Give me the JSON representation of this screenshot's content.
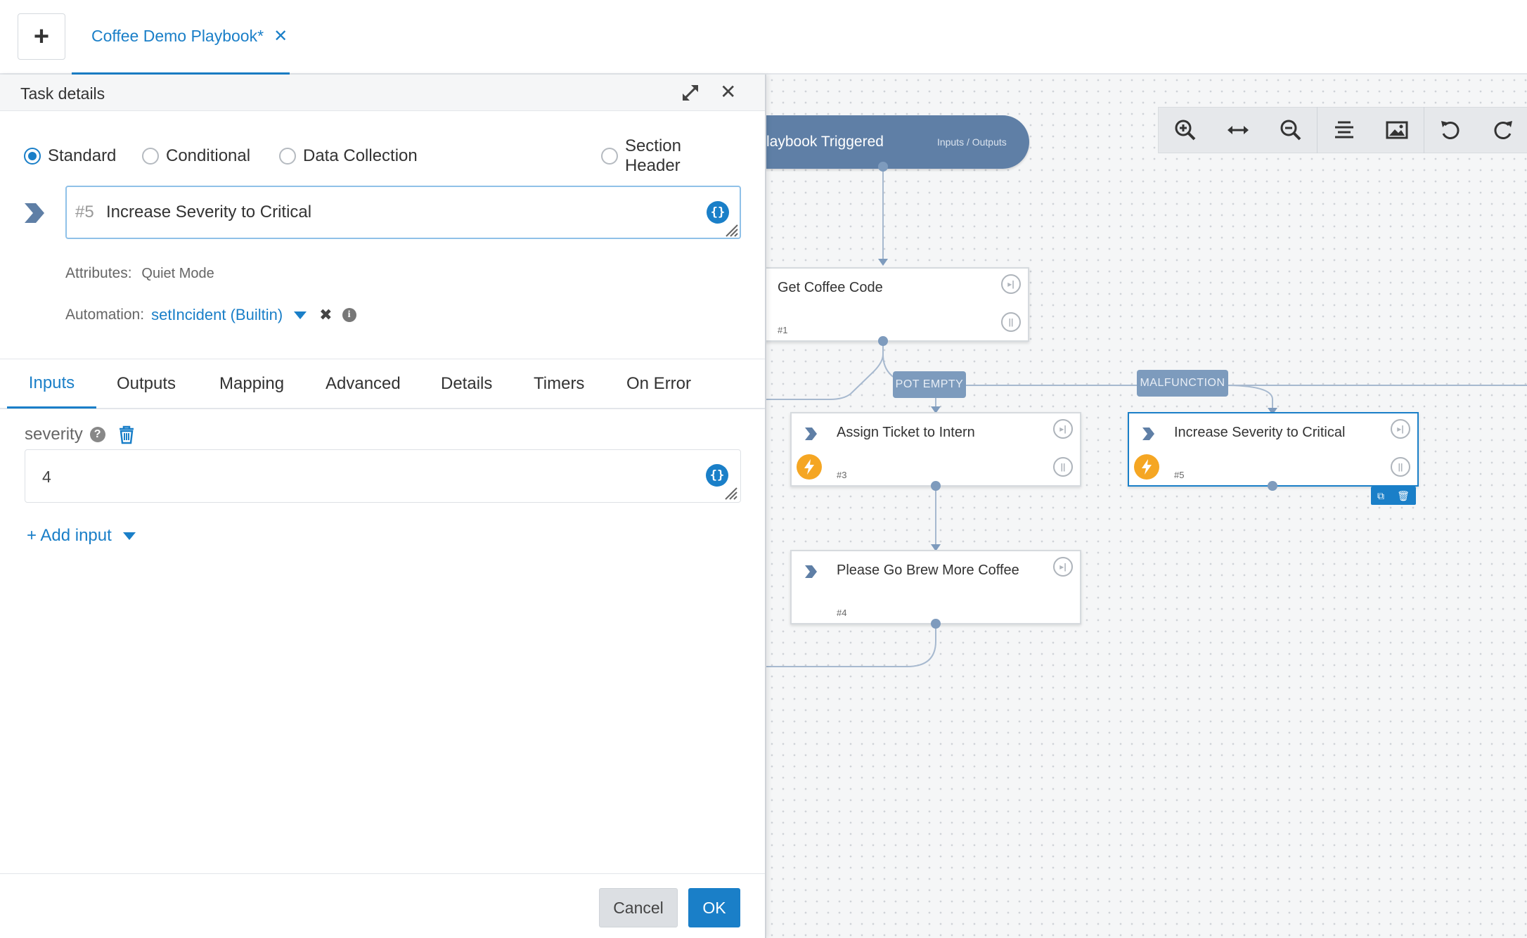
{
  "app": {
    "new_tab_icon": "plus-icon",
    "playbook_tab": {
      "label": "Coffee Demo Playbook*",
      "close_icon": "close-icon"
    }
  },
  "panel": {
    "title": "Task details",
    "task_types": [
      {
        "label": "Standard",
        "selected": true
      },
      {
        "label": "Conditional",
        "selected": false
      },
      {
        "label": "Data Collection",
        "selected": false
      },
      {
        "label": "Section Header",
        "selected": false
      }
    ],
    "task_number": "#5",
    "task_name": "Increase Severity to Critical",
    "attributes_label": "Attributes:",
    "attributes_value": "Quiet Mode",
    "automation_label": "Automation:",
    "automation_value": "setIncident (Builtin)",
    "tabs": [
      "Inputs",
      "Outputs",
      "Mapping",
      "Advanced",
      "Details",
      "Timers",
      "On Error"
    ],
    "active_tab": "Inputs",
    "input": {
      "name": "severity",
      "value": "4"
    },
    "add_input_label": "+ Add input",
    "cancel_label": "Cancel",
    "ok_label": "OK"
  },
  "canvas": {
    "toolbar_icons": [
      "zoom-in-icon",
      "fit-width-icon",
      "zoom-out-icon",
      "align-icon",
      "image-icon",
      "undo-icon",
      "redo-icon"
    ],
    "trigger": {
      "label": "laybook Triggered",
      "io_label": "Inputs / Outputs"
    },
    "tasks": [
      {
        "name": "Get Coffee Code",
        "number": "#1"
      },
      {
        "name": "Assign Ticket to Intern",
        "number": "#3"
      },
      {
        "name": "Increase Severity to Critical",
        "number": "#5"
      },
      {
        "name": "Please Go Brew More Coffee",
        "number": "#4"
      }
    ],
    "conditions": [
      "POT EMPTY",
      "MALFUNCTION"
    ]
  },
  "colors": {
    "accent": "#1a7fc8",
    "node": "#5f7fa6",
    "condition": "#7d9bbd",
    "automation_badge": "#f5a623"
  }
}
